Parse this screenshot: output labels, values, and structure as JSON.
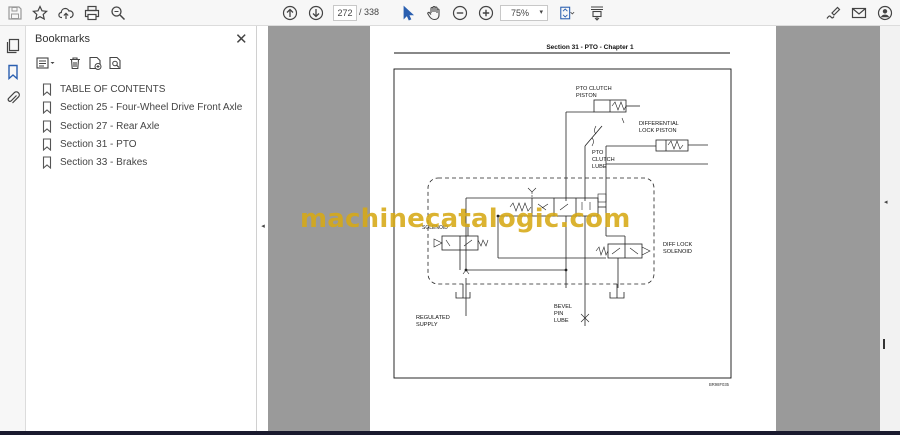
{
  "toolbar": {
    "page_current": "272",
    "page_separator": "/",
    "page_total": "338",
    "zoom_value": "75%",
    "zoom_caret": "▾"
  },
  "bookmarks_panel": {
    "title": "Bookmarks",
    "close_glyph": "✕",
    "items": [
      {
        "label": "TABLE OF CONTENTS"
      },
      {
        "label": "Section 25 - Four-Wheel Drive Front Axle"
      },
      {
        "label": "Section 27 - Rear Axle"
      },
      {
        "label": "Section 31 - PTO"
      },
      {
        "label": "Section 33 - Brakes"
      }
    ]
  },
  "document": {
    "header": "Section 31 - PTO - Chapter 1",
    "labels": {
      "pto_clutch": "PTO  CLUTCH",
      "piston": "PISTON",
      "differential": "DIFFERENTIAL",
      "lock_piston": "LOCK PISTON",
      "pto": "PTO",
      "clutch": "CLUTCH",
      "lube": "LUBE",
      "diff_lock": "DIFF LOCK",
      "solenoid": "SOLENOID",
      "regulated": "REGULATED",
      "supply": "SUPPLY",
      "bevel": "BEVEL",
      "pin": "PIN",
      "lube2": "LUBE",
      "solenoid_left": "SOLENOID",
      "figure_id": "BR98F035"
    }
  },
  "watermark": "machinecatalogic.com",
  "side_arrows": {
    "left": "◂",
    "right": "◂"
  },
  "colors": {
    "watermark": "#d6a814",
    "viewer_bg": "#9a9a9a"
  }
}
